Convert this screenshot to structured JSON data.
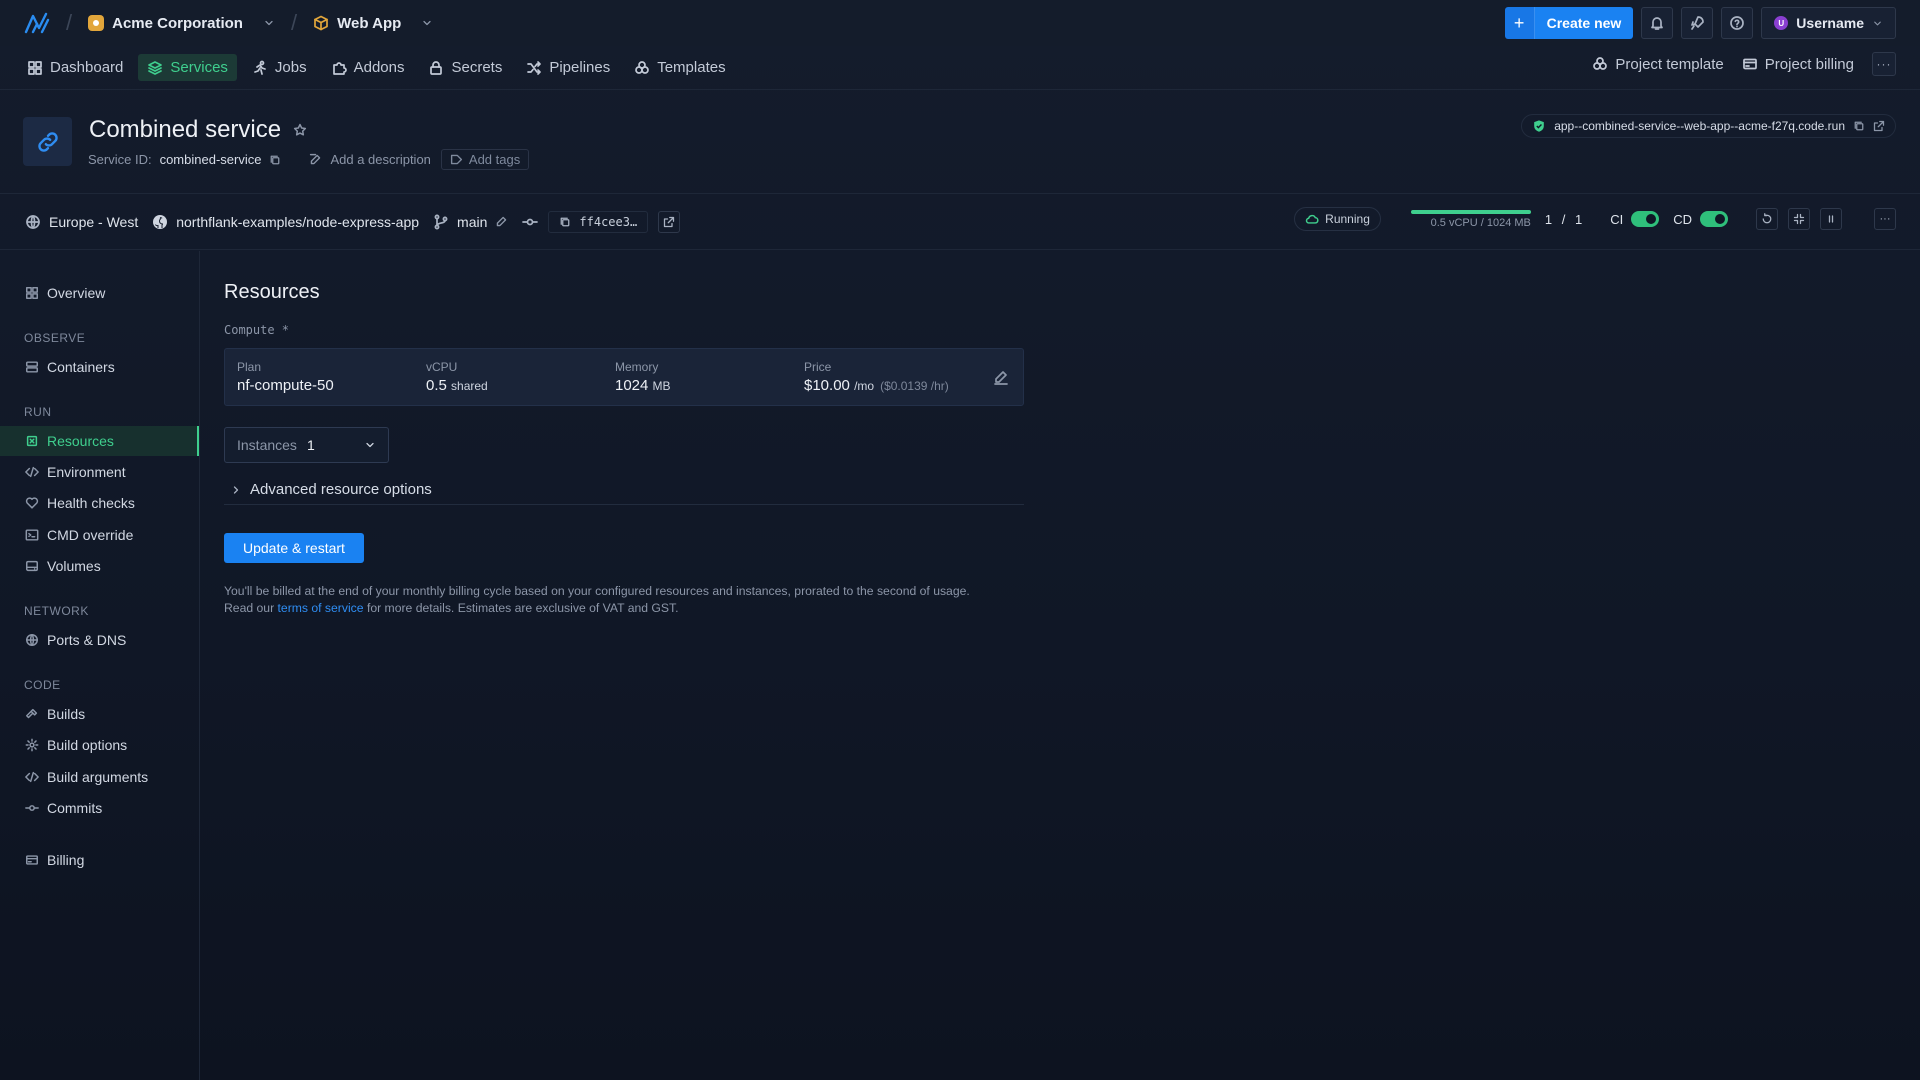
{
  "topbar": {
    "org_name": "Acme Corporation",
    "project_name": "Web App",
    "create_label": "Create new",
    "user_initial": "U",
    "username": "Username"
  },
  "nav": {
    "items": [
      {
        "label": "Dashboard",
        "icon": "grid-icon"
      },
      {
        "label": "Services",
        "icon": "layers-icon"
      },
      {
        "label": "Jobs",
        "icon": "runner-icon"
      },
      {
        "label": "Addons",
        "icon": "puzzle-icon"
      },
      {
        "label": "Secrets",
        "icon": "lock-icon"
      },
      {
        "label": "Pipelines",
        "icon": "shuffle-icon"
      },
      {
        "label": "Templates",
        "icon": "template-icon"
      }
    ],
    "active": "Services",
    "project_template": "Project template",
    "project_billing": "Project billing"
  },
  "service": {
    "title": "Combined service",
    "id_label": "Service ID:",
    "id_value": "combined-service",
    "description_placeholder": "Add a description",
    "tags_label": "Add tags",
    "url": "app--combined-service--web-app--acme-f27q.code.run"
  },
  "status": {
    "region": "Europe - West",
    "repo": "northflank-examples/node-express-app",
    "branch": "main",
    "commit": "ff4cee3…",
    "state": "Running",
    "usage_label": "0.5 vCPU / 1024 MB",
    "usage_fraction": 1.0,
    "instances_running": "1",
    "instances_sep": "/",
    "instances_total": "1",
    "ci_label": "CI",
    "cd_label": "CD",
    "ci_enabled": true,
    "cd_enabled": true
  },
  "sidebar": {
    "overview": "Overview",
    "observe_head": "OBSERVE",
    "containers": "Containers",
    "run_head": "RUN",
    "resources": "Resources",
    "environment": "Environment",
    "health_checks": "Health checks",
    "cmd_override": "CMD override",
    "volumes": "Volumes",
    "network_head": "NETWORK",
    "ports_dns": "Ports & DNS",
    "code_head": "CODE",
    "builds": "Builds",
    "build_options": "Build options",
    "build_arguments": "Build arguments",
    "commits": "Commits",
    "billing": "Billing"
  },
  "main": {
    "title": "Resources",
    "compute_label": "Compute *",
    "plan": {
      "plan_key": "Plan",
      "plan_value": "nf-compute-50",
      "vcpu_key": "vCPU",
      "vcpu_value": "0.5",
      "vcpu_unit": "shared",
      "memory_key": "Memory",
      "memory_value": "1024",
      "memory_unit": "MB",
      "price_key": "Price",
      "price_value": "$10.00",
      "price_unit": "/mo",
      "price_hourly": "($0.0139 /hr)"
    },
    "instances_label": "Instances",
    "instances_value": "1",
    "advanced_label": "Advanced resource options",
    "update_button": "Update & restart",
    "note_part1": "You'll be billed at the end of your monthly billing cycle based on your configured resources and instances, prorated to the second of usage.",
    "note_part2": "Read our",
    "note_link": "terms of service",
    "note_part3": "for more details. Estimates are exclusive of VAT and GST."
  },
  "colors": {
    "accent": "#1a82f2",
    "success": "#3fcf8e",
    "background": "#121a29"
  }
}
